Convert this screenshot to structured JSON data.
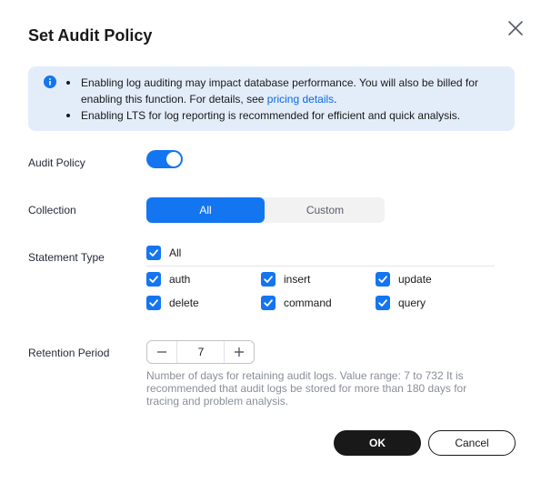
{
  "dialog": {
    "title": "Set Audit Policy",
    "info": {
      "line1_text": "Enabling log auditing may impact database performance. You will also be billed for enabling this function. For details, see ",
      "line1_link": "pricing details",
      "line1_end": ".",
      "line2_text": "Enabling LTS for log reporting is recommended for efficient and quick analysis."
    },
    "audit_policy": {
      "label": "Audit Policy",
      "enabled": true
    },
    "collection": {
      "label": "Collection",
      "options": [
        "All",
        "Custom"
      ],
      "selected": "All"
    },
    "statement_type": {
      "label": "Statement Type",
      "all_label": "All",
      "items": [
        "auth",
        "insert",
        "update",
        "delete",
        "command",
        "query"
      ],
      "checked": [
        true,
        true,
        true,
        true,
        true,
        true
      ]
    },
    "retention": {
      "label": "Retention Period",
      "value": "7",
      "hint": "Number of days for retaining audit logs. Value range: 7 to 732 It is recommended that audit logs be stored for more than 180 days for tracing and problem analysis."
    },
    "buttons": {
      "ok": "OK",
      "cancel": "Cancel"
    }
  },
  "colors": {
    "primary": "#1475f0",
    "info_bg": "#e3edfa",
    "link": "#0d6ae0",
    "ok_bg": "#191919"
  },
  "icons": {
    "close": "close-icon",
    "info": "info-icon",
    "check": "check-icon",
    "minus": "minus-icon",
    "plus": "plus-icon"
  }
}
